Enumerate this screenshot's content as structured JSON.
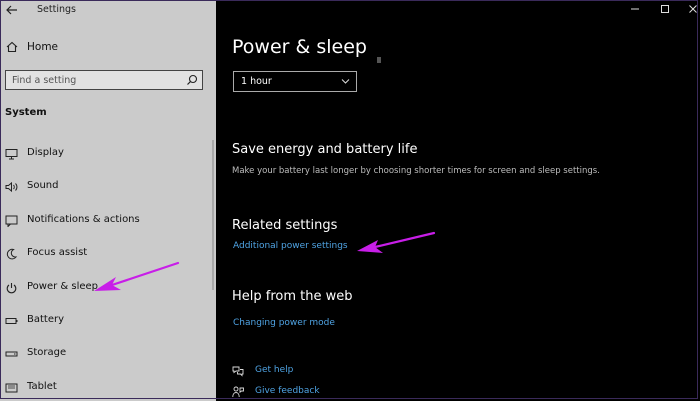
{
  "window": {
    "app_title": "Settings",
    "controls": {
      "minimize": "minimize",
      "maximize": "maximize",
      "close": "close"
    }
  },
  "sidebar": {
    "home_label": "Home",
    "search": {
      "placeholder": "Find a setting"
    },
    "section_title": "System",
    "items": [
      {
        "label": "Display",
        "icon": "display-icon"
      },
      {
        "label": "Sound",
        "icon": "sound-icon"
      },
      {
        "label": "Notifications & actions",
        "icon": "notifications-icon"
      },
      {
        "label": "Focus assist",
        "icon": "focus-assist-icon"
      },
      {
        "label": "Power & sleep",
        "icon": "power-icon"
      },
      {
        "label": "Battery",
        "icon": "battery-icon"
      },
      {
        "label": "Storage",
        "icon": "storage-icon"
      },
      {
        "label": "Tablet",
        "icon": "tablet-icon"
      }
    ]
  },
  "main": {
    "page_title": "Power & sleep",
    "sleep_dropdown": {
      "value": "1 hour"
    },
    "save_energy": {
      "title": "Save energy and battery life",
      "description": "Make your battery last longer by choosing shorter times for screen and sleep settings."
    },
    "related": {
      "title": "Related settings",
      "link": "Additional power settings"
    },
    "help": {
      "title": "Help from the web",
      "link": "Changing power mode"
    },
    "get_help": "Get help",
    "give_feedback": "Give feedback"
  },
  "colors": {
    "sidebar_bg": "#cbcbcb",
    "main_bg": "#000000",
    "link": "#4fa3e3",
    "annotation_arrow": "#c81ee8"
  }
}
